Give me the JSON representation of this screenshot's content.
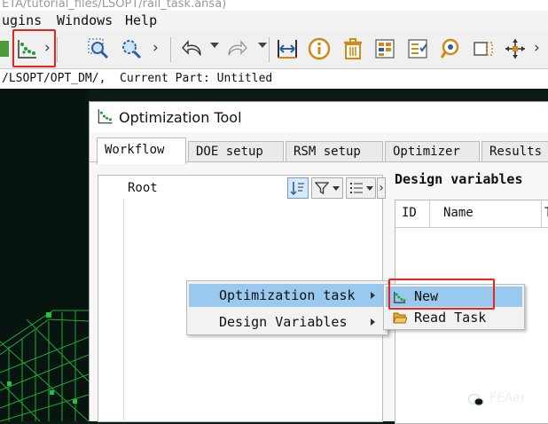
{
  "window": {
    "title": "ETA/tutorial_files/LSOPT/rail_task.ansa)"
  },
  "menubar": {
    "items": [
      "ugins",
      "Windows",
      "Help"
    ]
  },
  "status": {
    "path_text": "/LSOPT/OPT_DM/,  Current Part: Untitled"
  },
  "dialog": {
    "title": "Optimization Tool",
    "tabs": [
      "Workflow",
      "DOE setup",
      "RSM setup",
      "Optimizer",
      "Results"
    ],
    "active_tab": "Workflow",
    "tree": {
      "root_label": "Root"
    },
    "design_variables": {
      "title": "Design variables",
      "columns": [
        "ID",
        "Name",
        "T"
      ]
    }
  },
  "context_menu": {
    "items": [
      {
        "label": "Optimization task",
        "has_submenu": true,
        "highlighted": true
      },
      {
        "label": "Design Variables",
        "has_submenu": true,
        "highlighted": false
      }
    ]
  },
  "submenu": {
    "items": [
      {
        "label": "New",
        "icon": "optimization-tool-icon",
        "highlighted": true
      },
      {
        "label": "Read Task",
        "icon": "folder-open-icon",
        "highlighted": false
      }
    ]
  },
  "watermark": {
    "text": "FEAer"
  },
  "colors": {
    "highlight": "#99c9ef",
    "red_box": "#e8241c",
    "mesh_green": "#22c33a",
    "icon_blue": "#2a5fa8"
  }
}
